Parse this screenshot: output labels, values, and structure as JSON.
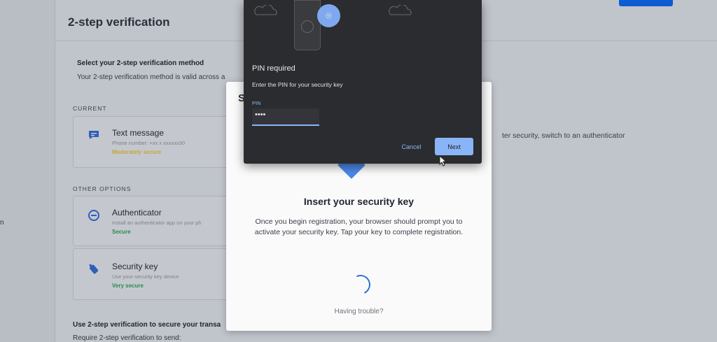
{
  "page": {
    "title": "2-step verification",
    "select_title": "Select your 2-step verification method",
    "select_subtitle": "Your 2-step verification method is valid across a",
    "current_label": "CURRENT",
    "other_label": "OTHER OPTIONS",
    "right_hint": "ter security, switch to an authenticator",
    "left_fragment": "n",
    "bottom_title": "Use 2-step verification to secure your transa",
    "bottom_subtitle": "Require 2-step verification to send:"
  },
  "methods": {
    "current": {
      "title": "Text message",
      "detail": "Phone number: +xx x xxxxxx30",
      "status": "Moderately secure",
      "status_color": "#c4a63a",
      "icon": "chat-icon"
    },
    "authenticator": {
      "title": "Authenticator",
      "detail": "Install an authenticator app on your ph",
      "status": "Secure",
      "status_color": "#2c8a4f",
      "icon": "authenticator-icon"
    },
    "security_key": {
      "title": "Security key",
      "detail": "Use your security key device",
      "status": "Very secure",
      "status_color": "#2c8a4f",
      "icon": "key-icon"
    }
  },
  "modal": {
    "header_fragment": "S",
    "title": "Insert your security key",
    "body": "Once you begin registration, your browser should prompt you to activate your security key. Tap your key to complete registration.",
    "trouble_link": "Having trouble?"
  },
  "pin_dialog": {
    "title": "PIN required",
    "description": "Enter the PIN for your security key",
    "pin_label": "PIN",
    "pin_value": "••••",
    "cancel_label": "Cancel",
    "next_label": "Next"
  }
}
